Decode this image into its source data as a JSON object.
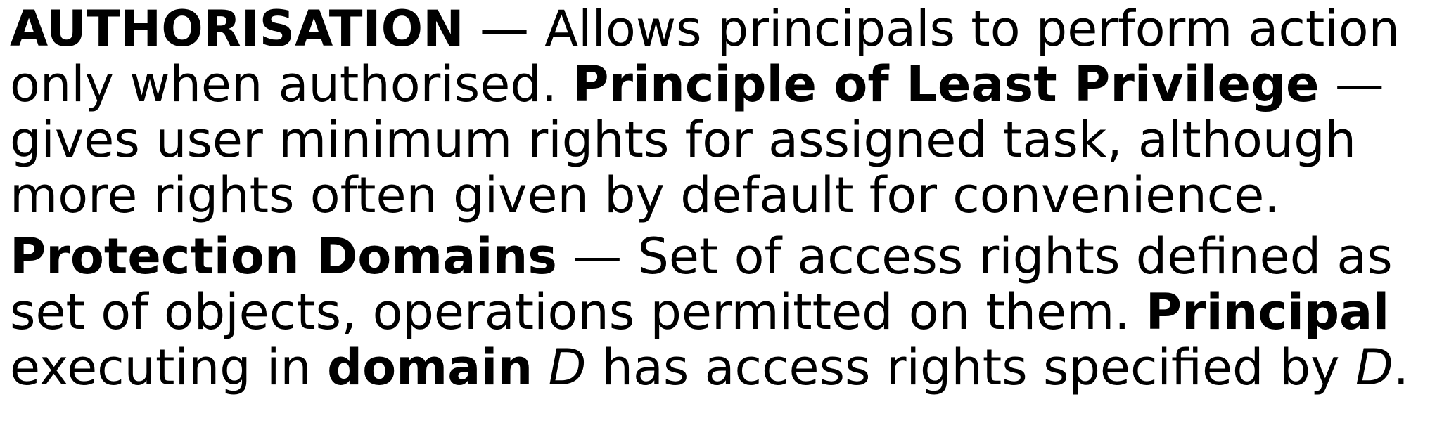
{
  "paragraphs": [
    {
      "lines": [
        {
          "term": "AUTHORISATION",
          "text": " — Allows principals to perform action"
        },
        {
          "text": "only when authorised. ",
          "term": "Principle of Least Privilege",
          "tail": " —"
        },
        {
          "text": "gives user minimum rights for assigned task, although"
        },
        {
          "text": "more rights often given by default for convenience."
        }
      ]
    },
    {
      "lines": [
        {
          "term": "Protection Domains",
          "text": " — Set of access rights defined as"
        },
        {
          "text": "set of objects, operations permitted on them. ",
          "term": "Principal"
        },
        {
          "text": "executing in ",
          "term": "domain",
          "var1": "D",
          "mid": " has access rights specified by ",
          "var2": "D",
          "end": "."
        }
      ]
    }
  ]
}
